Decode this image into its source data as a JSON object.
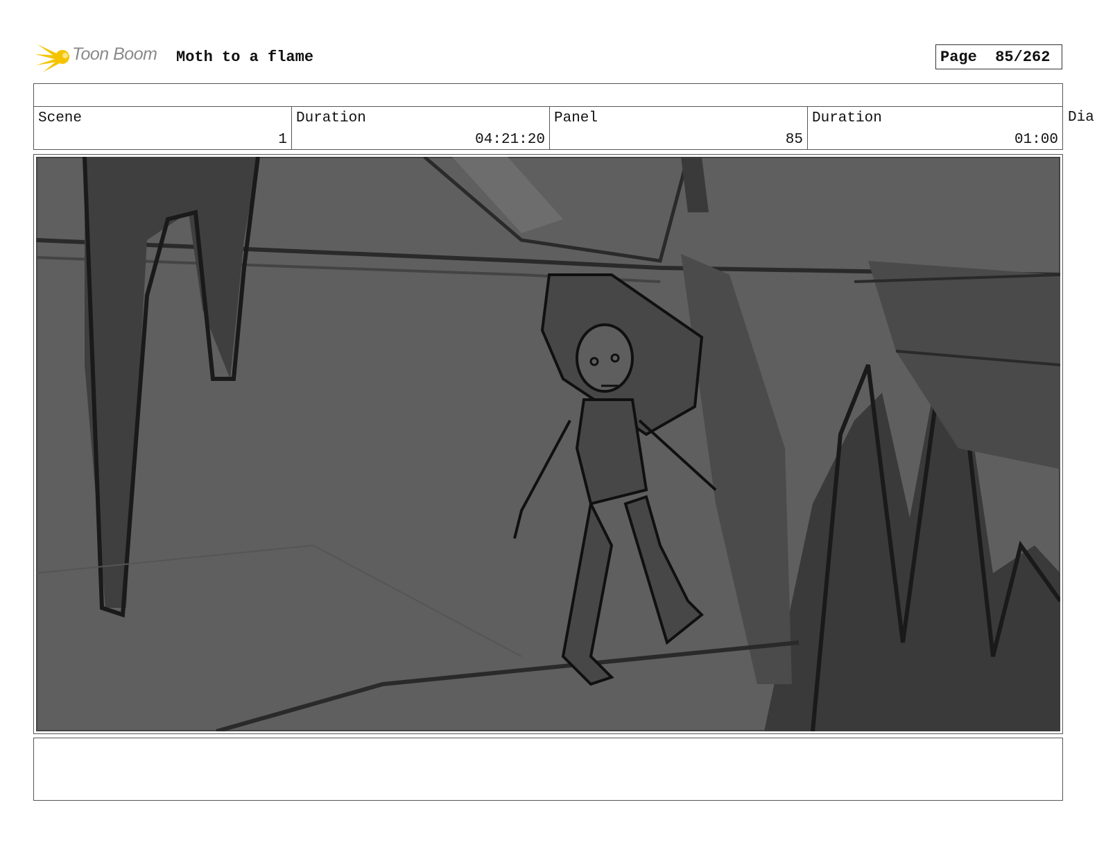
{
  "header": {
    "logo_text": "Toon Boom",
    "project_title": "Moth to a flame",
    "page_label": "Page",
    "page_value": "85/262"
  },
  "fields": [
    {
      "label": "Scene",
      "value": "1"
    },
    {
      "label": "Duration",
      "value": "04:21:20"
    },
    {
      "label": "Panel",
      "value": "85"
    },
    {
      "label": "Duration",
      "value": "01:00"
    }
  ],
  "dialog_label": "Dia",
  "colors": {
    "logo_yellow": "#f5c400",
    "panel_bg": "#5f5f5f",
    "sketch_line": "#1c1c1c"
  }
}
